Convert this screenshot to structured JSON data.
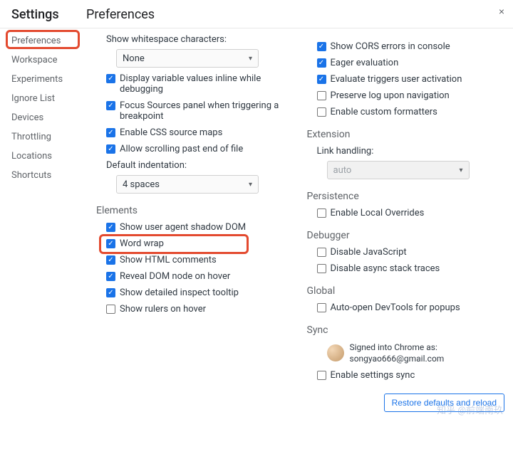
{
  "header": {
    "title": "Settings",
    "subtitle": "Preferences",
    "close": "×"
  },
  "sidebar": {
    "items": [
      {
        "label": "Preferences"
      },
      {
        "label": "Workspace"
      },
      {
        "label": "Experiments"
      },
      {
        "label": "Ignore List"
      },
      {
        "label": "Devices"
      },
      {
        "label": "Throttling"
      },
      {
        "label": "Locations"
      },
      {
        "label": "Shortcuts"
      }
    ]
  },
  "left": {
    "whitespace_label": "Show whitespace characters:",
    "whitespace_value": "None",
    "display_inline": "Display variable values inline while debugging",
    "focus_sources": "Focus Sources panel when triggering a breakpoint",
    "css_maps": "Enable CSS source maps",
    "scroll_past": "Allow scrolling past end of file",
    "indent_label": "Default indentation:",
    "indent_value": "4 spaces",
    "elements_title": "Elements",
    "shadow_dom": "Show user agent shadow DOM",
    "word_wrap": "Word wrap",
    "html_comments": "Show HTML comments",
    "reveal_hover": "Reveal DOM node on hover",
    "detailed_tooltip": "Show detailed inspect tooltip",
    "rulers_hover": "Show rulers on hover"
  },
  "right": {
    "cors": "Show CORS errors in console",
    "eager": "Eager evaluation",
    "eval_activation": "Evaluate triggers user activation",
    "preserve_log": "Preserve log upon navigation",
    "custom_fmt": "Enable custom formatters",
    "extension_title": "Extension",
    "link_handling_label": "Link handling:",
    "link_handling_value": "auto",
    "persistence_title": "Persistence",
    "local_overrides": "Enable Local Overrides",
    "debugger_title": "Debugger",
    "disable_js": "Disable JavaScript",
    "disable_async": "Disable async stack traces",
    "global_title": "Global",
    "auto_open": "Auto-open DevTools for popups",
    "sync_title": "Sync",
    "sync_line1": "Signed into Chrome as:",
    "sync_line2": "songyao666@gmail.com",
    "enable_sync": "Enable settings sync",
    "restore": "Restore defaults and reload"
  },
  "watermark": "知乎 @前端南玖"
}
